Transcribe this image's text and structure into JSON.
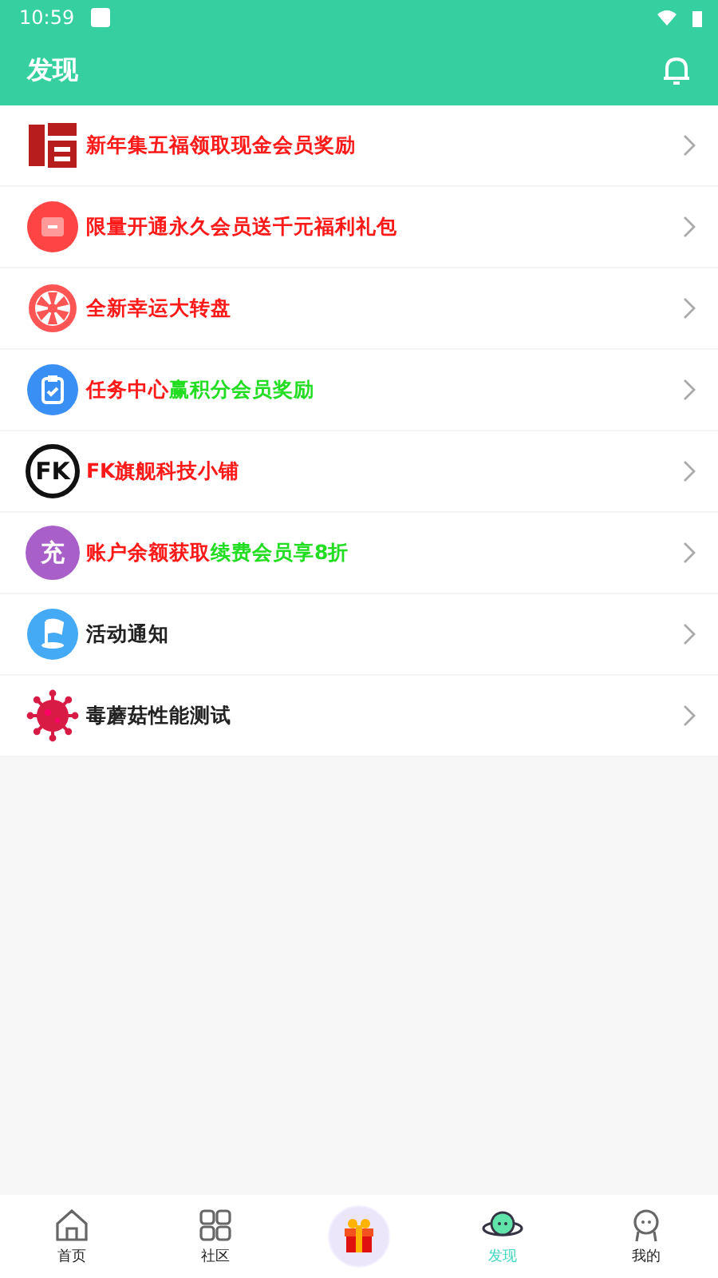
{
  "status_bar": {
    "time": "10:59"
  },
  "header": {
    "title": "发现"
  },
  "items": [
    {
      "kind": "fu",
      "segments": [
        {
          "text": "新年集五福领取现金会员奖励",
          "color": "#ff1a1a"
        }
      ]
    },
    {
      "kind": "shop",
      "segments": [
        {
          "text": "限量开通永久会员送千元福利礼包",
          "color": "#ff1a1a"
        }
      ]
    },
    {
      "kind": "wheel",
      "segments": [
        {
          "text": "全新幸运大转盘",
          "color": "#ff1a1a"
        }
      ]
    },
    {
      "kind": "task",
      "segments": [
        {
          "text": "任务中心",
          "color": "#ff1a1a"
        },
        {
          "text": "赢积分会员奖励",
          "color": "#22dd22"
        }
      ]
    },
    {
      "kind": "fk",
      "icon_text": "FK",
      "segments": [
        {
          "text": "FK旗舰科技小铺",
          "color": "#ff1a1a"
        }
      ]
    },
    {
      "kind": "charge",
      "icon_text": "充",
      "segments": [
        {
          "text": "账户余额获取",
          "color": "#ff1a1a"
        },
        {
          "text": "续费会员享8折",
          "color": "#22dd22"
        }
      ]
    },
    {
      "kind": "flag",
      "segments": [
        {
          "text": "活动通知",
          "color": "#222222"
        }
      ]
    },
    {
      "kind": "virus",
      "segments": [
        {
          "text": "毒蘑菇性能测试",
          "color": "#222222"
        }
      ]
    }
  ],
  "tabs": [
    {
      "kind": "home",
      "label": "首页",
      "selected": false
    },
    {
      "kind": "grid",
      "label": "社区",
      "selected": false
    },
    {
      "kind": "gift",
      "selected": false
    },
    {
      "kind": "planet",
      "label": "发现",
      "selected": true
    },
    {
      "kind": "face",
      "label": "我的",
      "selected": false
    }
  ]
}
